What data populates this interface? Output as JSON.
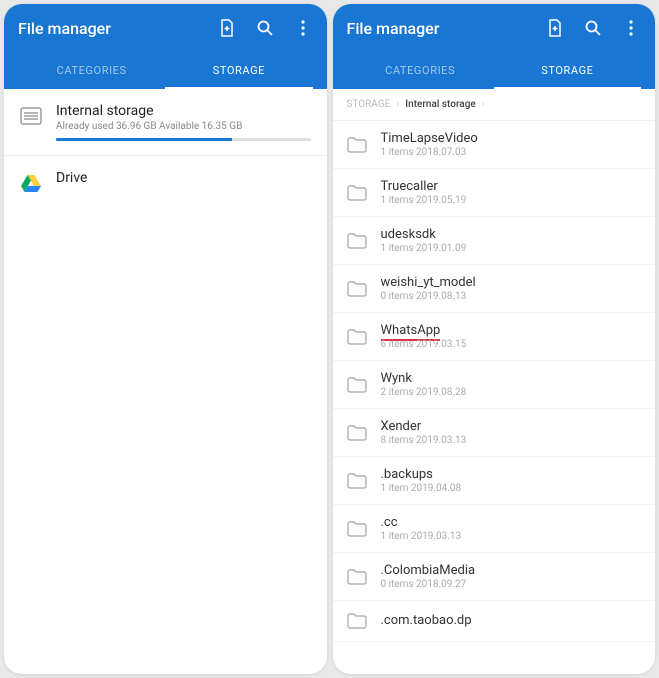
{
  "leftPhone": {
    "title": "File manager",
    "tabs": {
      "categories": "CATEGORIES",
      "storage": "STORAGE"
    },
    "internal": {
      "name": "Internal storage",
      "sub": "Already used 36.96 GB  Available 16.35 GB",
      "usedPercent": 69
    },
    "drive": {
      "name": "Drive"
    }
  },
  "rightPhone": {
    "title": "File manager",
    "tabs": {
      "categories": "CATEGORIES",
      "storage": "STORAGE"
    },
    "breadcrumb": {
      "root": "STORAGE",
      "current": "Internal storage"
    },
    "folders": [
      {
        "name": "TimeLapseVideo",
        "sub": "1 items  2018.07.03"
      },
      {
        "name": "Truecaller",
        "sub": "1 items  2019.05.19"
      },
      {
        "name": "udesksdk",
        "sub": "1 items  2019.01.09"
      },
      {
        "name": "weishi_yt_model",
        "sub": "0 items  2019.08.13"
      },
      {
        "name": "WhatsApp",
        "sub": "6 items  2019.03.15",
        "highlight": true
      },
      {
        "name": "Wynk",
        "sub": "2 items  2019.08.28"
      },
      {
        "name": "Xender",
        "sub": "8 items  2019.03.13"
      },
      {
        "name": ".backups",
        "sub": "1 item  2019.04.08"
      },
      {
        "name": ".cc",
        "sub": "1 item  2019.03.13"
      },
      {
        "name": ".ColombiaMedia",
        "sub": "0 items  2018.09.27"
      },
      {
        "name": ".com.taobao.dp",
        "sub": ""
      }
    ]
  }
}
